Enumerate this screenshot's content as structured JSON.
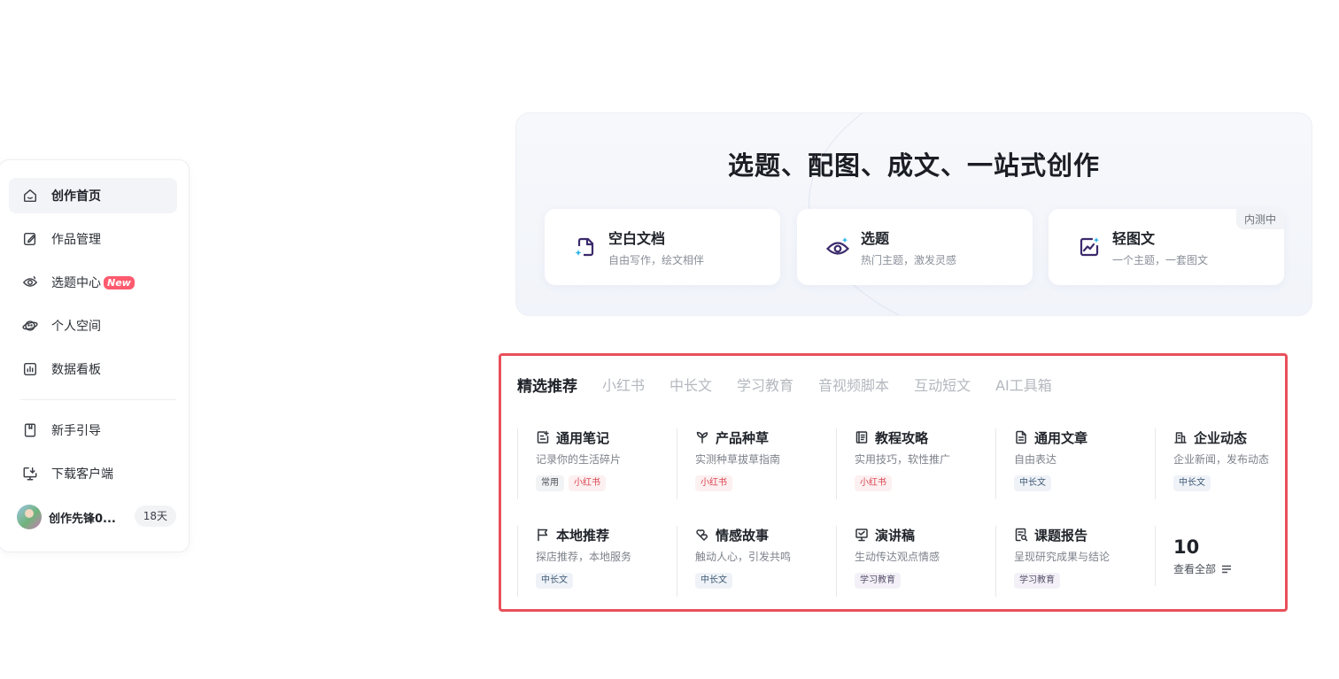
{
  "sidebar": {
    "items": [
      {
        "label": "创作首页",
        "icon": "home-icon",
        "active": true
      },
      {
        "label": "作品管理",
        "icon": "edit-icon"
      },
      {
        "label": "选题中心",
        "icon": "eye-icon",
        "badge": "New"
      },
      {
        "label": "个人空间",
        "icon": "planet-icon"
      },
      {
        "label": "数据看板",
        "icon": "chart-icon"
      }
    ],
    "bottom_items": [
      {
        "label": "新手引导",
        "icon": "bookmark-icon"
      },
      {
        "label": "下载客户端",
        "icon": "monitor-download-icon"
      }
    ],
    "user": {
      "name": "创作先锋0...",
      "days": "18天"
    }
  },
  "hero": {
    "title": "选题、配图、成文、一站式创作",
    "cards": [
      {
        "title": "空白文档",
        "subtitle": "自由写作，绘文相伴",
        "icon": "blank-doc-icon"
      },
      {
        "title": "选题",
        "subtitle": "热门主题，激发灵感",
        "icon": "eye-sparkle-icon"
      },
      {
        "title": "轻图文",
        "subtitle": "一个主题，一套图文",
        "icon": "image-sparkle-icon",
        "tag": "内测中"
      }
    ]
  },
  "templates": {
    "tabs": [
      "精选推荐",
      "小红书",
      "中长文",
      "学习教育",
      "音视频脚本",
      "互动短文",
      "AI工具箱"
    ],
    "active_tab": "精选推荐",
    "items": [
      {
        "title": "通用笔记",
        "desc": "记录你的生活碎片",
        "icon": "note-icon",
        "tags": [
          {
            "text": "常用",
            "style": "gray"
          },
          {
            "text": "小红书",
            "style": "red"
          }
        ]
      },
      {
        "title": "产品种草",
        "desc": "实测种草拔草指南",
        "icon": "sprout-icon",
        "tags": [
          {
            "text": "小红书",
            "style": "red"
          }
        ]
      },
      {
        "title": "教程攻略",
        "desc": "实用技巧，软性推广",
        "icon": "book-icon",
        "tags": [
          {
            "text": "小红书",
            "style": "red"
          }
        ]
      },
      {
        "title": "通用文章",
        "desc": "自由表达",
        "icon": "doc-icon",
        "tags": [
          {
            "text": "中长文",
            "style": "blue"
          }
        ]
      },
      {
        "title": "企业动态",
        "desc": "企业新闻，发布动态",
        "icon": "building-icon",
        "tags": [
          {
            "text": "中长文",
            "style": "blue"
          }
        ]
      },
      {
        "title": "本地推荐",
        "desc": "探店推荐，本地服务",
        "icon": "flag-icon",
        "tags": [
          {
            "text": "中长文",
            "style": "blue"
          }
        ]
      },
      {
        "title": "情感故事",
        "desc": "触动人心，引发共鸣",
        "icon": "hearts-icon",
        "tags": [
          {
            "text": "中长文",
            "style": "blue"
          }
        ]
      },
      {
        "title": "演讲稿",
        "desc": "生动传达观点情感",
        "icon": "podium-icon",
        "tags": [
          {
            "text": "学习教育",
            "style": "purple"
          }
        ]
      },
      {
        "title": "课题报告",
        "desc": "呈现研究成果与结论",
        "icon": "report-icon",
        "tags": [
          {
            "text": "学习教育",
            "style": "purple"
          }
        ]
      }
    ],
    "more": {
      "count": "10",
      "label": "查看全部"
    }
  },
  "colors": {
    "accent_red": "#e8505b",
    "badge_new": "#ff5a6e"
  }
}
